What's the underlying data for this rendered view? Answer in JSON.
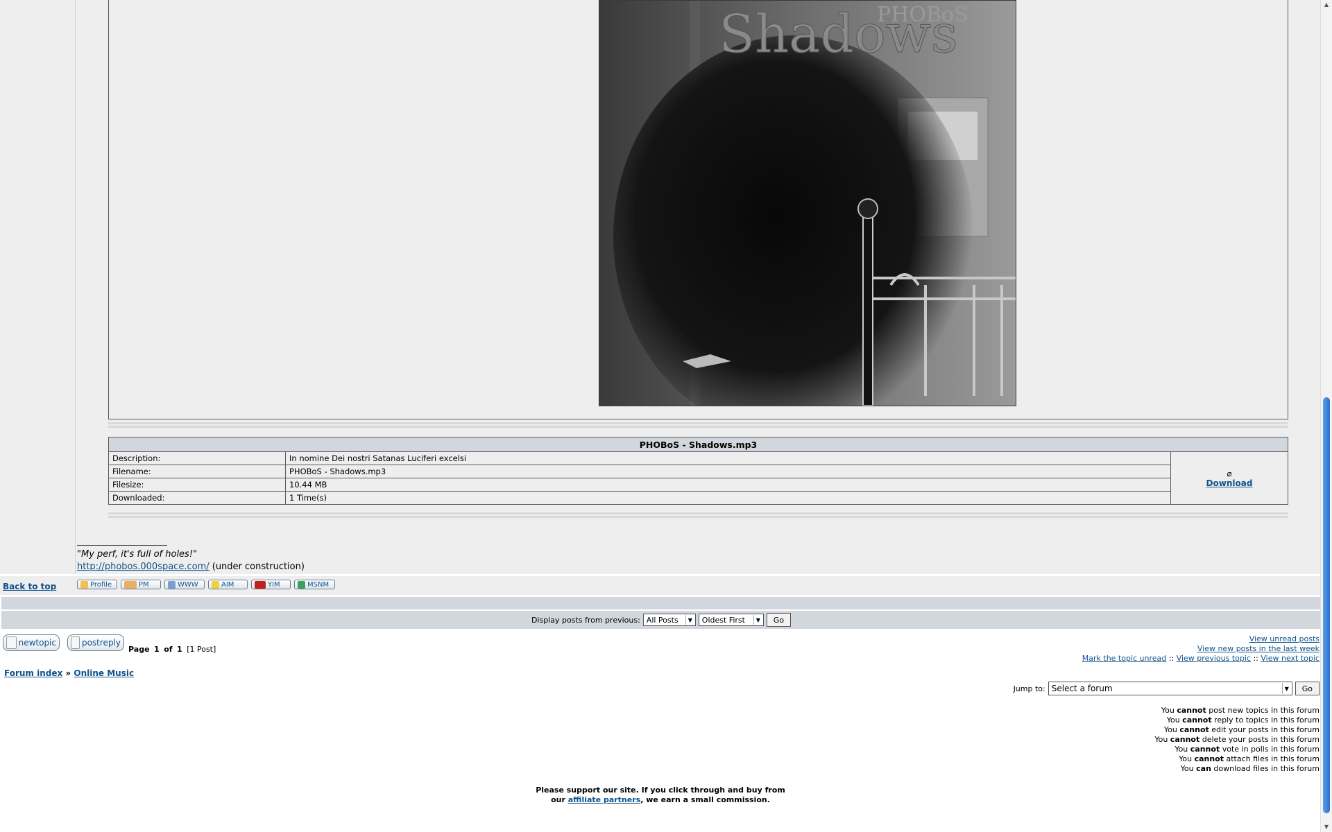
{
  "attachment_image": {
    "alt_text": "PHOBoS Shadows",
    "band_name": "PHOBoS",
    "album_title": "Shadows"
  },
  "attachment": {
    "title": "PHOBoS - Shadows.mp3",
    "rows": [
      {
        "key": "Description:",
        "value": "In nomine Dei nostri Satanas Luciferi excelsi"
      },
      {
        "key": "Filename:",
        "value": "PHOBoS - Shadows.mp3"
      },
      {
        "key": "Filesize:",
        "value": "10.44 MB"
      },
      {
        "key": "Downloaded:",
        "value": "1 Time(s)"
      }
    ],
    "download_label": "Download"
  },
  "signature": {
    "quote": "\"My perf, it's full of holes!\"",
    "url": "http://phobos.000space.com/",
    "url_suffix": " (under construction)"
  },
  "post_footer": {
    "back_to_top": "Back to top",
    "buttons": {
      "profile": "Profile",
      "pm": "PM",
      "www": "WWW",
      "aim": "AIM",
      "yim": "YIM",
      "msnm": "MSNM"
    }
  },
  "display_posts": {
    "label": "Display posts from previous:",
    "period_selected": "All Posts",
    "order_selected": "Oldest First",
    "go": "Go"
  },
  "actions": {
    "new_topic": "newtopic",
    "post_reply": "postreply"
  },
  "pagination": {
    "prefix": "Page",
    "current": "1",
    "of": "of",
    "total": "1",
    "count": "[1 Post]"
  },
  "nav_links": {
    "view_unread": "View unread posts",
    "view_new_week": "View new posts in the last week",
    "mark_unread": "Mark the topic unread",
    "sep": "::",
    "prev_topic": "View previous topic",
    "next_topic": "View next topic"
  },
  "breadcrumb": {
    "index": "Forum index",
    "sep": "»",
    "forum": "Online Music"
  },
  "jump_to": {
    "label": "Jump to:",
    "selected": "Select a forum",
    "go": "Go"
  },
  "permissions": [
    {
      "pre": "You ",
      "strong": "cannot",
      "post": " post new topics in this forum"
    },
    {
      "pre": "You ",
      "strong": "cannot",
      "post": " reply to topics in this forum"
    },
    {
      "pre": "You ",
      "strong": "cannot",
      "post": " edit your posts in this forum"
    },
    {
      "pre": "You ",
      "strong": "cannot",
      "post": " delete your posts in this forum"
    },
    {
      "pre": "You ",
      "strong": "cannot",
      "post": " vote in polls in this forum"
    },
    {
      "pre": "You ",
      "strong": "cannot",
      "post": " attach files in this forum"
    },
    {
      "pre": "You ",
      "strong": "can",
      "post": " download files in this forum"
    }
  ],
  "footer": {
    "line1": "Please support our site. If you click through and buy from",
    "line2_pre": "our ",
    "line2_link": "affiliate partners",
    "line2_post": ", we earn a small commission."
  },
  "colors": {
    "link": "#105289",
    "post_bg": "#eeeeee",
    "bar_bg": "#d1d7dc",
    "scroll_thumb": "#2a6fcf"
  }
}
